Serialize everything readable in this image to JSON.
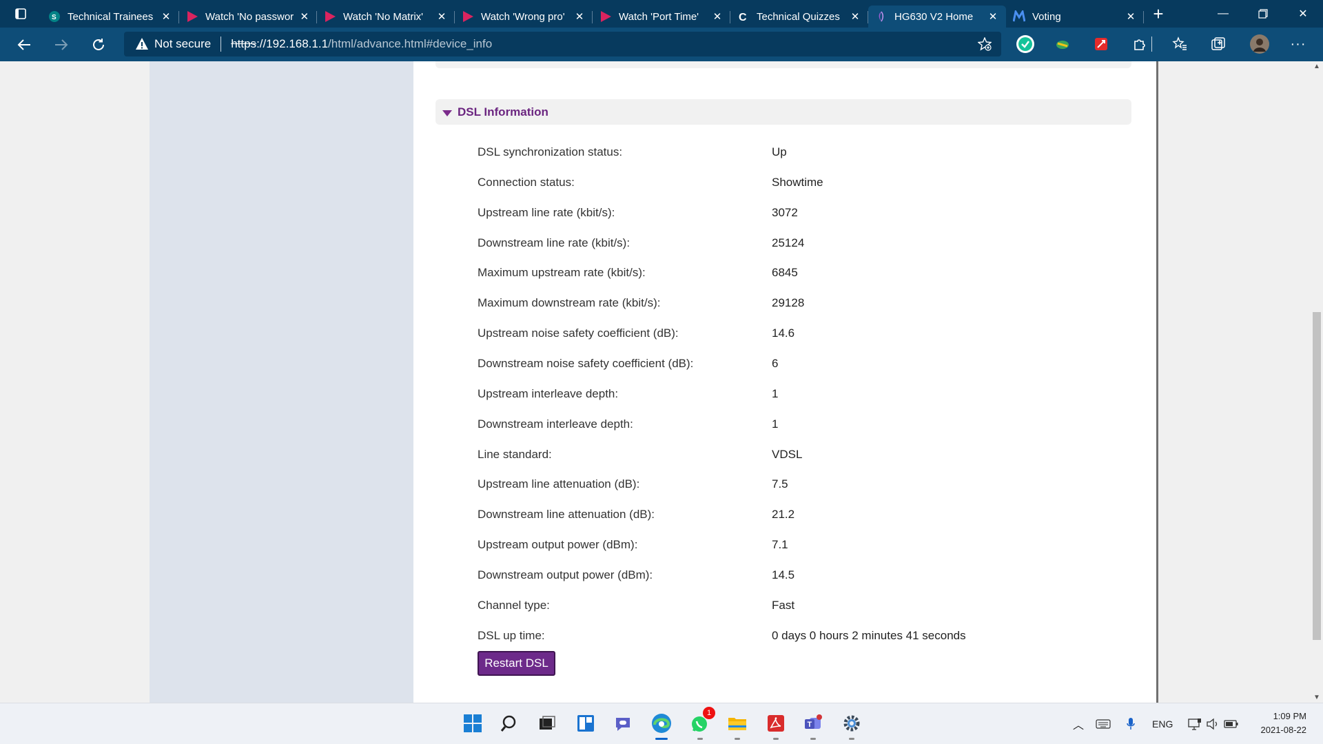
{
  "browser": {
    "tabs": [
      {
        "title": "Technical Trainees",
        "icon": "sharepoint-icon",
        "active": false
      },
      {
        "title": "Watch 'No password'",
        "icon": "play-icon",
        "active": false
      },
      {
        "title": "Watch 'No Matrix'",
        "icon": "play-icon",
        "active": false
      },
      {
        "title": "Watch 'Wrong pro'",
        "icon": "play-icon",
        "active": false
      },
      {
        "title": "Watch 'Port Time'",
        "icon": "play-icon",
        "active": false
      },
      {
        "title": "Technical Quizzes",
        "icon": "c-icon",
        "active": false
      },
      {
        "title": "HG630 V2 Home",
        "icon": "huawei-icon",
        "active": true
      },
      {
        "title": "Voting",
        "icon": "voting-icon",
        "active": false
      }
    ],
    "address": {
      "security_label": "Not secure",
      "scheme": "https",
      "host": "://192.168.1.1",
      "path": "/html/advance.html#device_info"
    }
  },
  "page": {
    "section_title": "DSL Information",
    "rows": [
      {
        "label": "DSL synchronization status:",
        "value": "Up"
      },
      {
        "label": "Connection status:",
        "value": "Showtime"
      },
      {
        "label": "Upstream line rate (kbit/s):",
        "value": "3072"
      },
      {
        "label": "Downstream line rate (kbit/s):",
        "value": "25124"
      },
      {
        "label": "Maximum upstream rate (kbit/s):",
        "value": "6845"
      },
      {
        "label": "Maximum downstream rate (kbit/s):",
        "value": "29128"
      },
      {
        "label": "Upstream noise safety coefficient (dB):",
        "value": "14.6"
      },
      {
        "label": "Downstream noise safety coefficient (dB):",
        "value": "6"
      },
      {
        "label": "Upstream interleave depth:",
        "value": "1"
      },
      {
        "label": "Downstream interleave depth:",
        "value": "1"
      },
      {
        "label": "Line standard:",
        "value": "VDSL"
      },
      {
        "label": "Upstream line attenuation (dB):",
        "value": "7.5"
      },
      {
        "label": "Downstream line attenuation (dB):",
        "value": "21.2"
      },
      {
        "label": "Upstream output power (dBm):",
        "value": "7.1"
      },
      {
        "label": "Downstream output power (dBm):",
        "value": "14.5"
      },
      {
        "label": "Channel type:",
        "value": "Fast"
      },
      {
        "label": "DSL up time:",
        "value": "0 days 0 hours 2 minutes 41 seconds"
      }
    ],
    "restart_label": "Restart DSL"
  },
  "taskbar": {
    "whatsapp_badge": "1",
    "language": "ENG",
    "time": "1:09 PM",
    "date": "2021-08-22"
  },
  "colors": {
    "accent_purple": "#6d2a8a",
    "browser_frame": "#073a5e",
    "toolbar": "#0e4d78",
    "left_panel": "#dde3ec"
  }
}
